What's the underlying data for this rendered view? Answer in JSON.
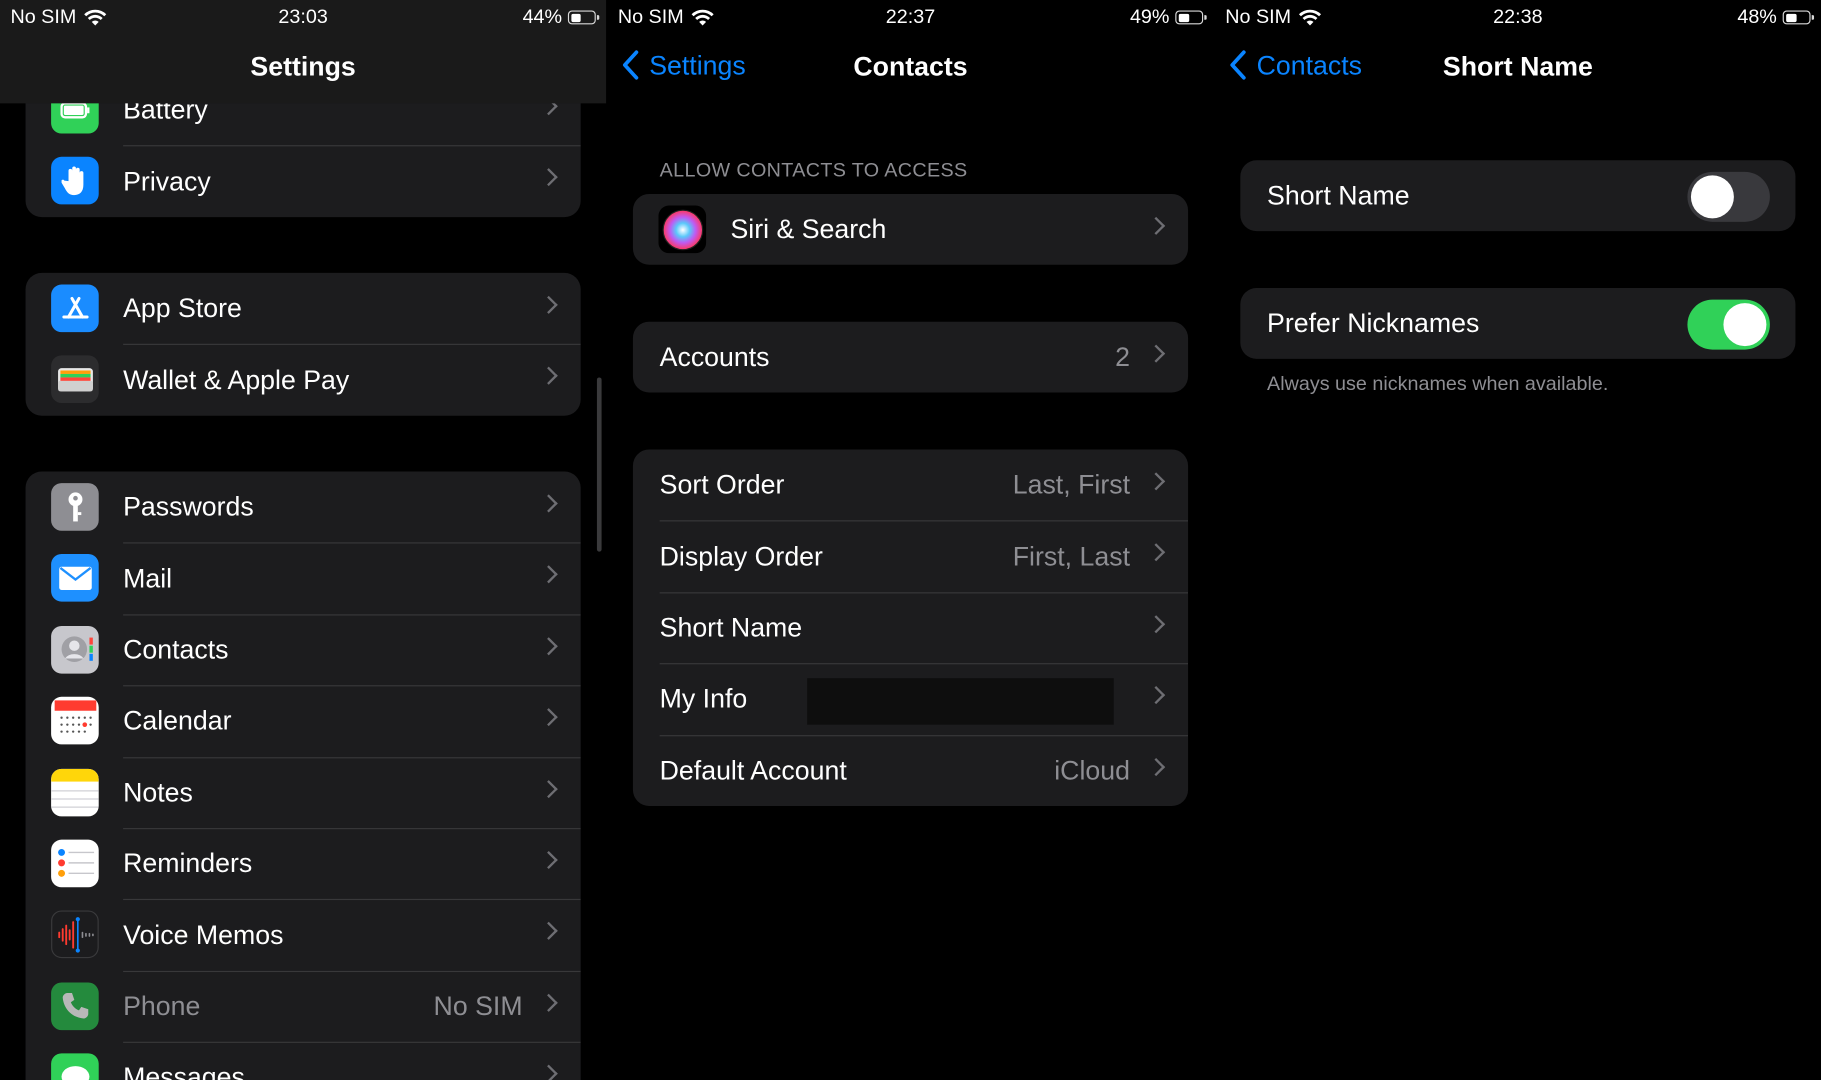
{
  "panel1": {
    "status": {
      "carrier": "No SIM",
      "time": "23:03",
      "battery": "44%",
      "battery_level": 0.44
    },
    "title": "Settings",
    "group_a": [
      {
        "label": "Battery",
        "icon": "battery-icon"
      },
      {
        "label": "Privacy",
        "icon": "hand-icon"
      }
    ],
    "group_b": [
      {
        "label": "App Store",
        "icon": "app-store-icon"
      },
      {
        "label": "Wallet & Apple Pay",
        "icon": "wallet-icon"
      }
    ],
    "group_c": [
      {
        "label": "Passwords",
        "icon": "key-icon"
      },
      {
        "label": "Mail",
        "icon": "envelope-icon"
      },
      {
        "label": "Contacts",
        "icon": "contacts-icon"
      },
      {
        "label": "Calendar",
        "icon": "calendar-icon"
      },
      {
        "label": "Notes",
        "icon": "notes-icon"
      },
      {
        "label": "Reminders",
        "icon": "reminders-icon"
      },
      {
        "label": "Voice Memos",
        "icon": "waveform-icon"
      },
      {
        "label": "Phone",
        "value": "No SIM",
        "icon": "phone-icon"
      },
      {
        "label": "Messages",
        "icon": "message-icon"
      }
    ]
  },
  "panel2": {
    "status": {
      "carrier": "No SIM",
      "time": "22:37",
      "battery": "49%",
      "battery_level": 0.49
    },
    "back": "Settings",
    "title": "Contacts",
    "section_header": "ALLOW CONTACTS TO ACCESS",
    "siri_label": "Siri & Search",
    "accounts_label": "Accounts",
    "accounts_value": "2",
    "rows": [
      {
        "label": "Sort Order",
        "value": "Last, First"
      },
      {
        "label": "Display Order",
        "value": "First, Last"
      },
      {
        "label": "Short Name",
        "value": ""
      },
      {
        "label": "My Info",
        "value": ""
      },
      {
        "label": "Default Account",
        "value": "iCloud"
      }
    ]
  },
  "panel3": {
    "status": {
      "carrier": "No SIM",
      "time": "22:38",
      "battery": "48%",
      "battery_level": 0.48
    },
    "back": "Contacts",
    "title": "Short Name",
    "short_name_label": "Short Name",
    "short_name_on": false,
    "prefer_label": "Prefer Nicknames",
    "prefer_on": true,
    "footer": "Always use nicknames when available."
  },
  "colors": {
    "accent": "#0a84ff",
    "toggle_on": "#30d158",
    "cell": "#1c1c1e"
  }
}
